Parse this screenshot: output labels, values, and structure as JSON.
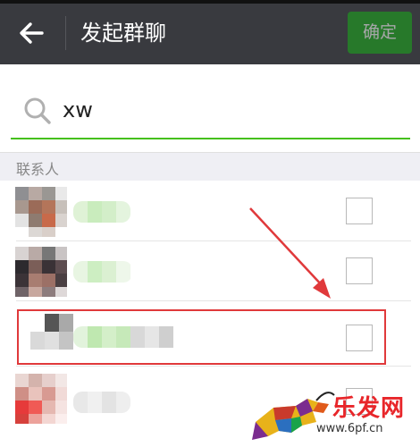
{
  "header": {
    "title": "发起群聊",
    "confirm_label": "确定",
    "back_icon": "arrow-left-icon"
  },
  "search": {
    "query": "xw",
    "icon": "search-icon",
    "accent_color": "#45c01a"
  },
  "contacts": {
    "section_label": "联系人",
    "items": [
      {
        "checked": false
      },
      {
        "checked": false
      },
      {
        "checked": false,
        "highlighted": true
      },
      {
        "checked": false
      }
    ]
  },
  "watermark": {
    "text": "乐发网",
    "url": "www.6pf.cn"
  },
  "colors": {
    "topbar": "#393a3f",
    "confirm_button": "#1aad19",
    "highlight_box": "#e0393b",
    "annotation_arrow": "#e0393b"
  }
}
